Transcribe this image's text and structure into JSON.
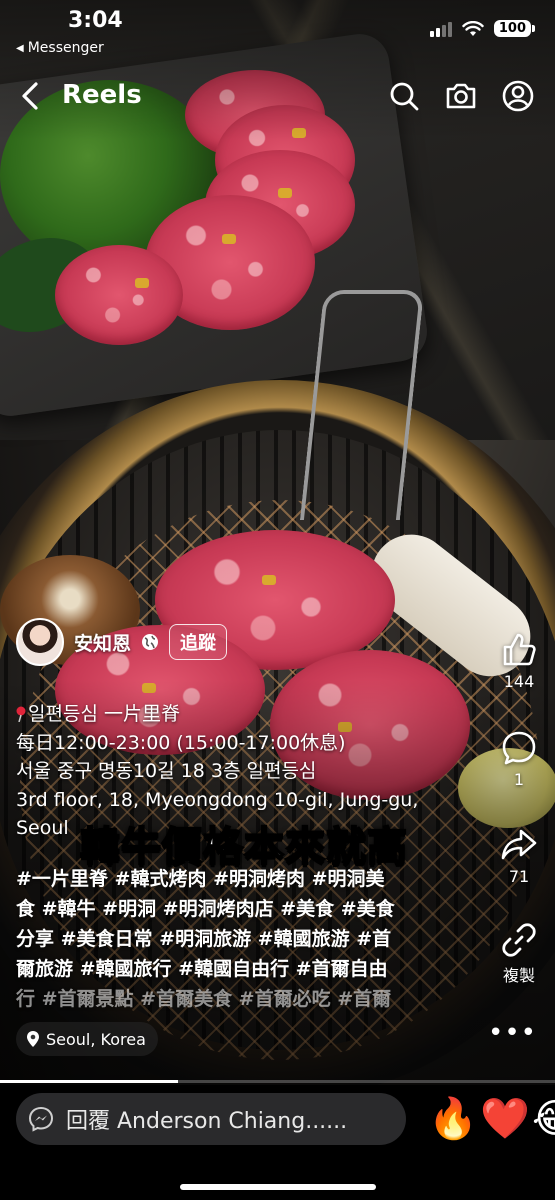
{
  "status_bar": {
    "time": "3:04",
    "back_app": "Messenger",
    "battery": "100"
  },
  "header": {
    "title": "Reels",
    "icons": [
      "back-arrow-icon",
      "search-icon",
      "camera-icon",
      "profile-icon"
    ]
  },
  "author": {
    "name": "安知恩",
    "follow_label": "追蹤"
  },
  "caption": {
    "lines": [
      "일편등심 一片里脊",
      "每日12:00-23:00 (15:00-17:00休息)",
      "서울 중구 명동10길 18 3층 일편등심",
      "3rd floor, 18, Myeongdong 10-gil, Jung-gu,",
      "Seoul"
    ]
  },
  "overlay_text": "韓牛價格本來就高",
  "hashtags": {
    "lines": [
      "#一片里脊 #韓式烤肉 #明洞烤肉 #明洞美",
      "食 #韓牛 #明洞 #明洞烤肉店 #美食 #美食",
      "分享 #美食日常 #明洞旅游 #韓國旅游 #首",
      "爾旅游 #韓國旅行 #韓國自由行 #首爾自由",
      "行 #首爾景點 #首爾美食 #首爾必吃 #首爾"
    ]
  },
  "actions": {
    "like_count": "144",
    "comment_count": "1",
    "share_count": "71",
    "copy_label": "複製"
  },
  "location": "Seoul, Korea",
  "progress": 0.32,
  "reply": {
    "placeholder": "回覆 Anderson Chiang......",
    "emojis": [
      "🔥",
      "❤️",
      "😂"
    ]
  },
  "colors": {
    "accent_text": "#ffffff",
    "reply_bg": "#2a2a2c",
    "heart": "#e0243a"
  }
}
